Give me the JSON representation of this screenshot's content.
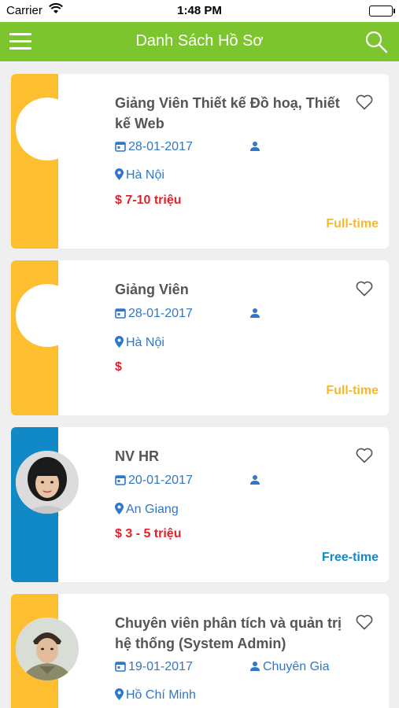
{
  "status_bar": {
    "carrier": "Carrier",
    "time": "1:48 PM"
  },
  "header": {
    "title": "Danh Sách Hồ Sơ"
  },
  "cards": [
    {
      "title": "Giảng Viên Thiết kế Đồ hoạ, Thiết kế Web",
      "date": "28-01-2017",
      "role": "",
      "location": "Hà Nội",
      "salary": "$ 7-10 triệu",
      "job_type": "Full-time",
      "strip_color": "#fdbe2f",
      "type_color": "#f6b92b",
      "avatar": "blank"
    },
    {
      "title": "Giảng Viên",
      "date": "28-01-2017",
      "role": "",
      "location": "Hà Nội",
      "salary": "$",
      "job_type": "Full-time",
      "strip_color": "#fdbe2f",
      "type_color": "#f6b92b",
      "avatar": "blank"
    },
    {
      "title": "NV HR",
      "date": "20-01-2017",
      "role": "",
      "location": "An Giang",
      "salary": "$ 3 - 5 triệu",
      "job_type": "Free-time",
      "strip_color": "#1289c7",
      "type_color": "#1289c7",
      "avatar": "photo-woman"
    },
    {
      "title": "Chuyên viên phân tích và quản trị hệ thống (System Admin)",
      "date": "19-01-2017",
      "role": "Chuyên Gia",
      "location": "Hồ Chí Minh",
      "salary": "",
      "job_type": "",
      "strip_color": "#fdbe2f",
      "type_color": "#f6b92b",
      "avatar": "photo-man"
    }
  ]
}
